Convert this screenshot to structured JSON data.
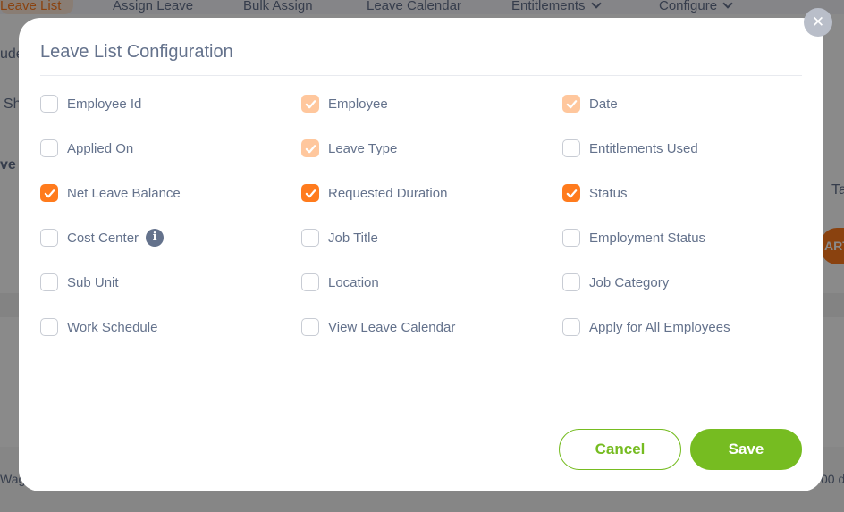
{
  "background": {
    "tabs": [
      {
        "label": "Leave List",
        "active": true
      },
      {
        "label": "Assign Leave"
      },
      {
        "label": "Bulk Assign"
      },
      {
        "label": "Leave Calendar"
      },
      {
        "label": "Entitlements"
      },
      {
        "label": "Configure"
      }
    ],
    "fragments": {
      "left1": "ude",
      "left2": "Sh",
      "left3": "ve",
      "right1": "Ta",
      "right_button": "ART",
      "bottom_left": "Wag",
      "bottom_right": "00 d"
    }
  },
  "modal": {
    "title": "Leave List Configuration",
    "close_symbol": "✕",
    "options": [
      {
        "label": "Employee Id",
        "state": "unchecked"
      },
      {
        "label": "Employee",
        "state": "checked-disabled"
      },
      {
        "label": "Date",
        "state": "checked-disabled"
      },
      {
        "label": "Applied On",
        "state": "unchecked"
      },
      {
        "label": "Leave Type",
        "state": "checked-disabled"
      },
      {
        "label": "Entitlements Used",
        "state": "unchecked"
      },
      {
        "label": "Net Leave Balance",
        "state": "checked"
      },
      {
        "label": "Requested Duration",
        "state": "checked"
      },
      {
        "label": "Status",
        "state": "checked"
      },
      {
        "label": "Cost Center",
        "state": "unchecked",
        "info_icon": true
      },
      {
        "label": "Job Title",
        "state": "unchecked"
      },
      {
        "label": "Employment Status",
        "state": "unchecked"
      },
      {
        "label": "Sub Unit",
        "state": "unchecked"
      },
      {
        "label": "Location",
        "state": "unchecked"
      },
      {
        "label": "Job Category",
        "state": "unchecked"
      },
      {
        "label": "Work Schedule",
        "state": "unchecked"
      },
      {
        "label": "View Leave Calendar",
        "state": "unchecked"
      },
      {
        "label": "Apply for All Employees",
        "state": "unchecked"
      }
    ],
    "info_symbol": "i",
    "cancel_label": "Cancel",
    "save_label": "Save"
  },
  "colors": {
    "accent": "#ff7b1d",
    "accent_disabled": "#ffc79d",
    "success": "#76bc21",
    "text": "#64728c"
  }
}
